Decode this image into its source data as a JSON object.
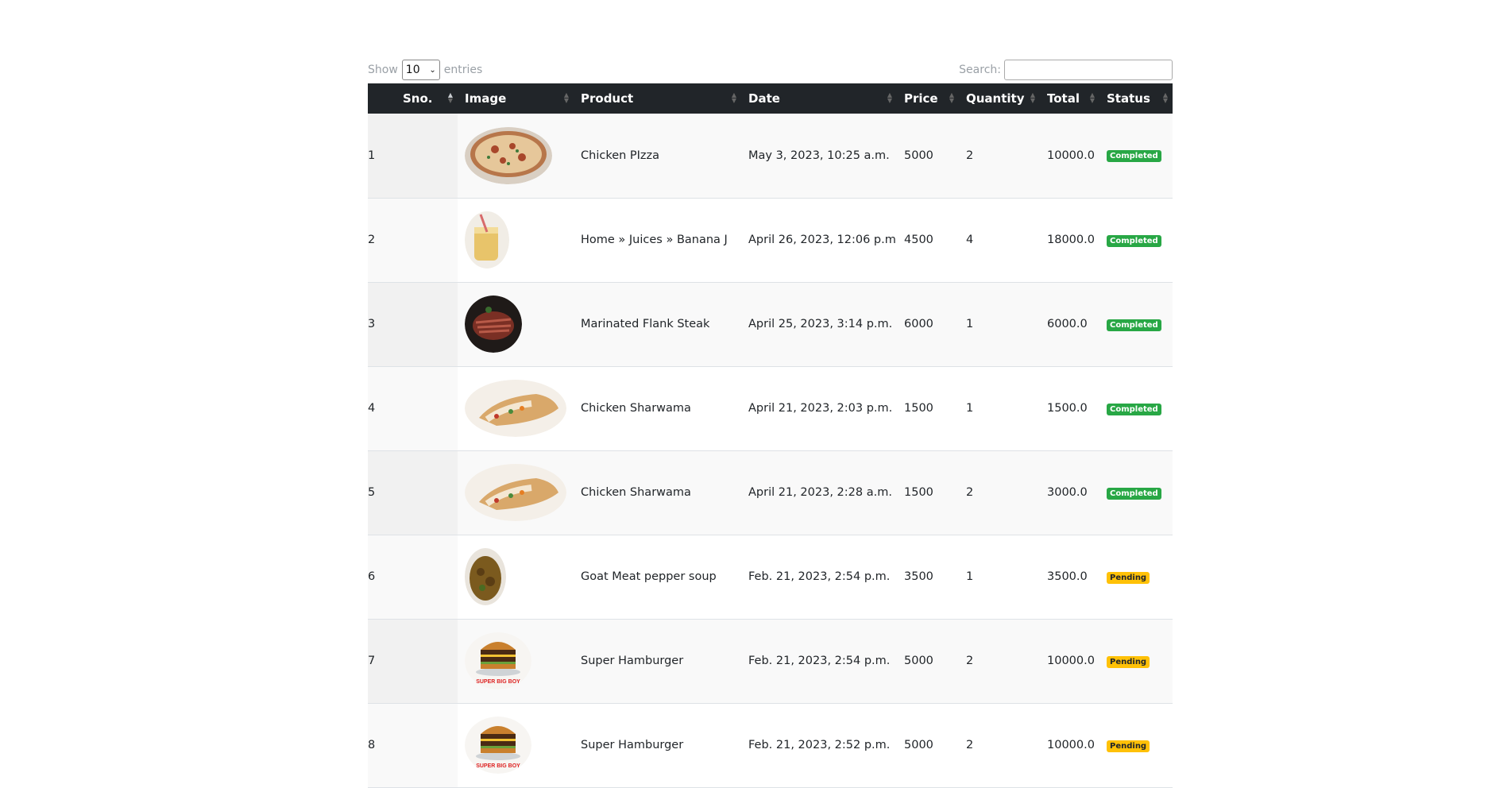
{
  "controls": {
    "show_label": "Show",
    "entries_value": "10",
    "entries_label": "entries",
    "search_label": "Search:",
    "search_value": ""
  },
  "columns": [
    "Sno.",
    "Image",
    "Product",
    "Date",
    "Price",
    "Quantity",
    "Total",
    "Status"
  ],
  "colors": {
    "header_bg": "#212529",
    "completed": "#28a745",
    "pending": "#ffc107"
  },
  "rows": [
    {
      "sno": "1",
      "image": "pizza",
      "product": "Chicken PIzza",
      "date": "May 3, 2023, 10:25 a.m.",
      "price": "5000",
      "quantity": "2",
      "total": "10000.0",
      "status": "Completed"
    },
    {
      "sno": "2",
      "image": "banana-juice",
      "product": "Home » Juices » Banana J",
      "date": "April 26, 2023, 12:06 p.m.",
      "price": "4500",
      "quantity": "4",
      "total": "18000.0",
      "status": "Completed"
    },
    {
      "sno": "3",
      "image": "steak",
      "product": "Marinated Flank Steak",
      "date": "April 25, 2023, 3:14 p.m.",
      "price": "6000",
      "quantity": "1",
      "total": "6000.0",
      "status": "Completed"
    },
    {
      "sno": "4",
      "image": "shawarma",
      "product": "Chicken Sharwama",
      "date": "April 21, 2023, 2:03 p.m.",
      "price": "1500",
      "quantity": "1",
      "total": "1500.0",
      "status": "Completed"
    },
    {
      "sno": "5",
      "image": "shawarma",
      "product": "Chicken Sharwama",
      "date": "April 21, 2023, 2:28 a.m.",
      "price": "1500",
      "quantity": "2",
      "total": "3000.0",
      "status": "Completed"
    },
    {
      "sno": "6",
      "image": "pepper-soup",
      "product": "Goat Meat pepper soup",
      "date": "Feb. 21, 2023, 2:54 p.m.",
      "price": "3500",
      "quantity": "1",
      "total": "3500.0",
      "status": "Pending"
    },
    {
      "sno": "7",
      "image": "hamburger",
      "product": "Super Hamburger",
      "date": "Feb. 21, 2023, 2:54 p.m.",
      "price": "5000",
      "quantity": "2",
      "total": "10000.0",
      "status": "Pending"
    },
    {
      "sno": "8",
      "image": "hamburger",
      "product": "Super Hamburger",
      "date": "Feb. 21, 2023, 2:52 p.m.",
      "price": "5000",
      "quantity": "2",
      "total": "10000.0",
      "status": "Pending"
    }
  ],
  "burger_logo_text": "SUPER BIG BOY"
}
